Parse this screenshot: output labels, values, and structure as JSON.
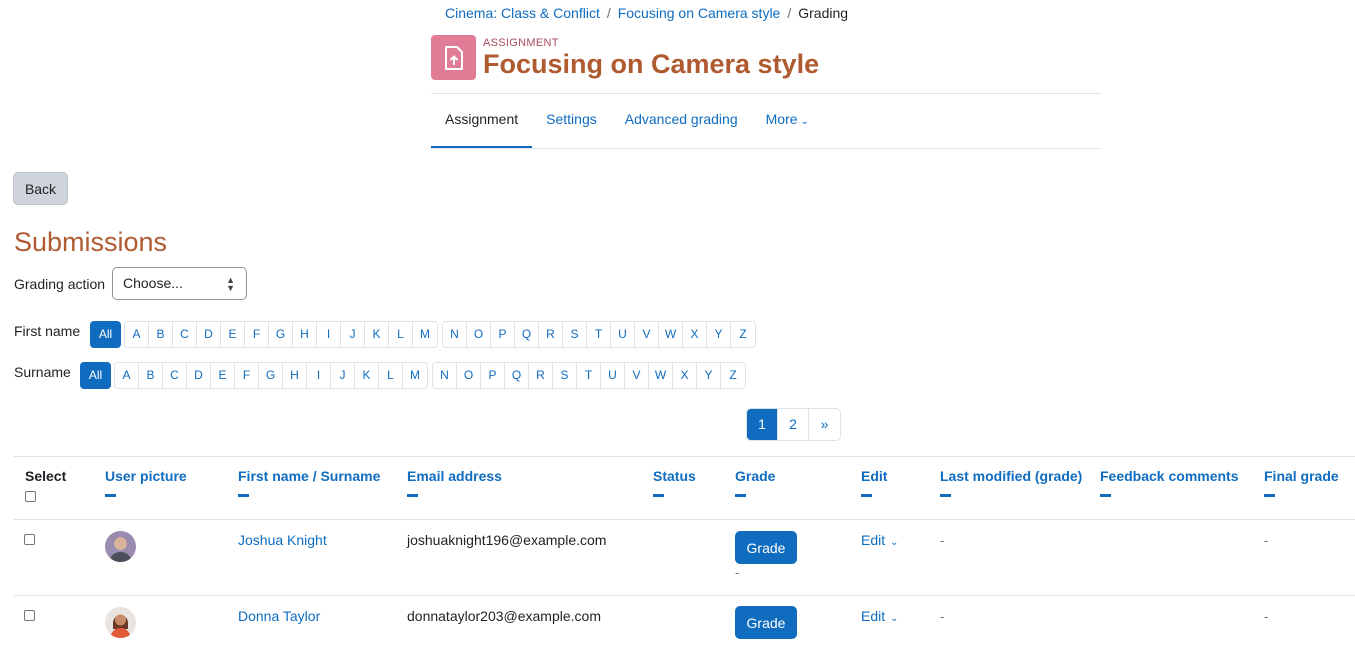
{
  "breadcrumb": {
    "course": "Cinema: Class & Conflict",
    "activity": "Focusing on Camera style",
    "current": "Grading"
  },
  "header": {
    "activity_type": "ASSIGNMENT",
    "title": "Focusing on Camera style",
    "icon": "assignment-upload-icon",
    "icon_color": "#e07c96"
  },
  "tabs": [
    {
      "label": "Assignment",
      "active": true
    },
    {
      "label": "Settings"
    },
    {
      "label": "Advanced grading"
    },
    {
      "label": "More"
    }
  ],
  "back_label": "Back",
  "section_title": "Submissions",
  "grading_action": {
    "label": "Grading action",
    "value": "Choose..."
  },
  "first_name_filter": {
    "label": "First name",
    "all": "All"
  },
  "surname_filter": {
    "label": "Surname",
    "all": "All"
  },
  "letters_a_m": [
    "A",
    "B",
    "C",
    "D",
    "E",
    "F",
    "G",
    "H",
    "I",
    "J",
    "K",
    "L",
    "M"
  ],
  "letters_n_z": [
    "N",
    "O",
    "P",
    "Q",
    "R",
    "S",
    "T",
    "U",
    "V",
    "W",
    "X",
    "Y",
    "Z"
  ],
  "pagination": {
    "pages": [
      "1",
      "2"
    ],
    "current": "1",
    "next": "»"
  },
  "table": {
    "headers": {
      "select": "Select",
      "user_picture": "User picture",
      "name": "First name / Surname",
      "email": "Email address",
      "status": "Status",
      "grade": "Grade",
      "edit": "Edit",
      "last_modified": "Last modified (grade)",
      "feedback": "Feedback comments",
      "final_grade": "Final grade"
    },
    "rows": [
      {
        "name": "Joshua Knight",
        "email": "joshuaknight196@example.com",
        "grade_button": "Grade",
        "grade_value": "-",
        "edit": "Edit",
        "last_modified": "-",
        "final_grade": "-"
      },
      {
        "name": "Donna Taylor",
        "email": "donnataylor203@example.com",
        "grade_button": "Grade",
        "edit": "Edit",
        "last_modified": "-",
        "final_grade": "-"
      }
    ]
  },
  "colors": {
    "primary": "#0f6cbf",
    "title": "#b05a30"
  }
}
